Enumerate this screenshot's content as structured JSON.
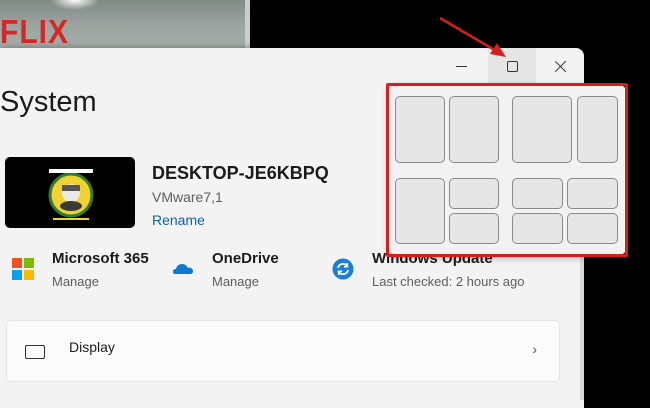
{
  "background": {
    "logo_text": "FLIX"
  },
  "window": {
    "caption_buttons": [
      {
        "name": "minimize",
        "icon": "minimize-icon"
      },
      {
        "name": "maximize",
        "icon": "maximize-icon"
      },
      {
        "name": "close",
        "icon": "close-icon"
      }
    ]
  },
  "page": {
    "title": "System"
  },
  "device": {
    "name": "DESKTOP-JE6KBPQ",
    "model": "VMware7,1",
    "rename_label": "Rename"
  },
  "quick_links": [
    {
      "title": "Microsoft 365",
      "subtitle": "Manage",
      "icon": "microsoft-365-icon"
    },
    {
      "title": "OneDrive",
      "subtitle": "Manage",
      "icon": "onedrive-icon"
    },
    {
      "title": "Windows Update",
      "subtitle": "Last checked: 2 hours ago",
      "icon": "windows-update-icon"
    }
  ],
  "settings_items": [
    {
      "label": "Display",
      "icon": "display-icon"
    }
  ],
  "snap_layouts": [
    {
      "name": "two-equal-columns",
      "zones": 2
    },
    {
      "name": "wide-left-narrow-right",
      "zones": 2
    },
    {
      "name": "left-column-two-right",
      "zones": 3
    },
    {
      "name": "four-quadrants",
      "zones": 4
    }
  ],
  "colors": {
    "accent_link": "#0e5fb3",
    "highlight_annotation": "#d91d1d",
    "window_background": "#f3f3f3"
  }
}
